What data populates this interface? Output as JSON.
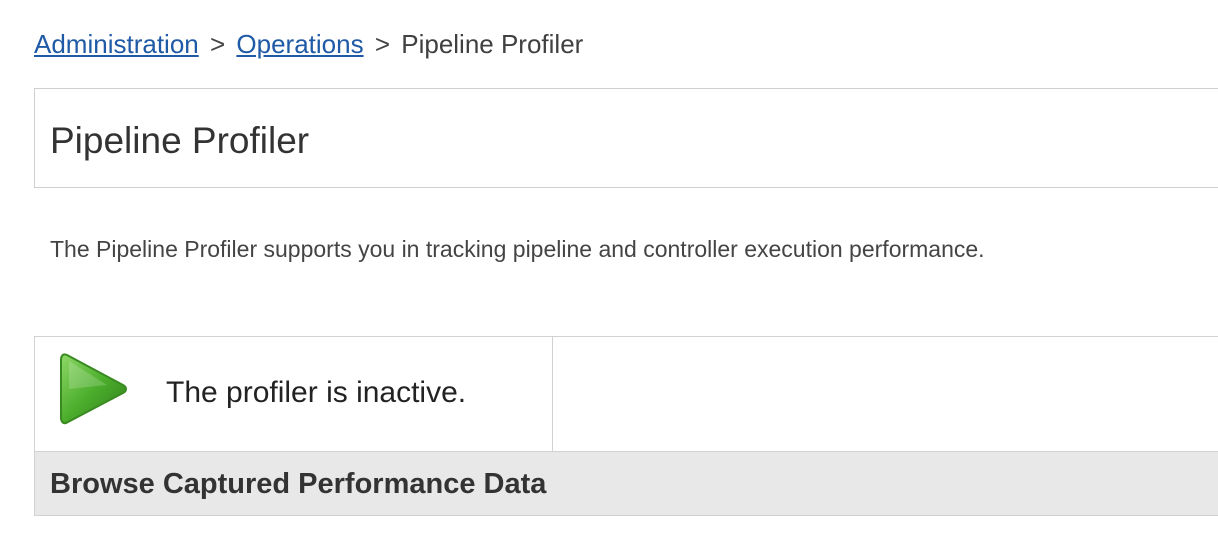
{
  "breadcrumb": {
    "items": [
      {
        "label": "Administration",
        "link": true
      },
      {
        "label": "Operations",
        "link": true
      },
      {
        "label": "Pipeline Profiler",
        "link": false
      }
    ],
    "separator": ">"
  },
  "page": {
    "title": "Pipeline Profiler",
    "description": "The Pipeline Profiler supports you in tracking pipeline and controller execution performance."
  },
  "profiler": {
    "status_text": "The profiler is inactive.",
    "start_icon": "play-icon",
    "icon_color": "#4caf2e"
  },
  "browse": {
    "heading": "Browse Captured Performance Data"
  }
}
